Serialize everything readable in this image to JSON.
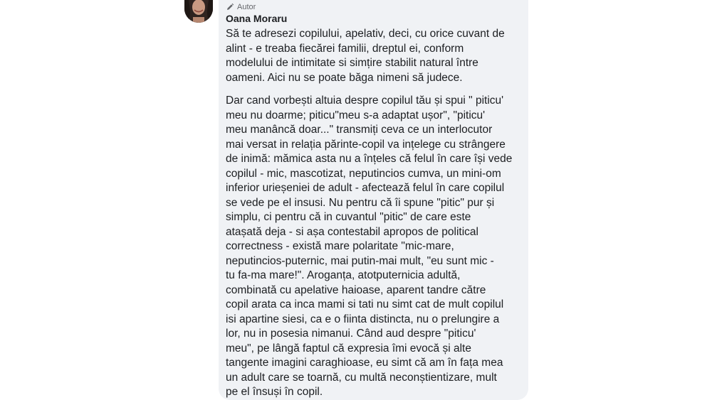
{
  "comment": {
    "badge_label": "Autor",
    "author_name": "Oana Moraru",
    "paragraph_1": [
      "Să te adresezi copilului, apelativ, deci, cu orice cuvant de",
      "alint - e treaba fiecărei familii, dreptul ei, conform",
      "modelului de intimitate si simțire stabilit natural între",
      "oameni. Aici nu se poate băga nimeni să judece."
    ],
    "paragraph_2": [
      "Dar cand vorbești altuia despre copilul tău și spui \" piticu'",
      "meu nu doarme; piticu\"meu s-a adaptat ușor\", \"piticu'",
      "meu manâncă doar...\" transmiți ceva ce un interlocutor",
      "mai versat in relația părinte-copil va ințelege cu strângere",
      "de inimă: mămica asta nu a înțeles că felul în care își vede",
      "copilul - mic, mascotizat, neputincios cumva, un mini-om",
      "inferior urieșeniei de adult - afectează felul în care copilul",
      "se vede pe el insusi. Nu pentru că îi spune \"pitic\" pur și",
      "simplu, ci pentru că in cuvantul \"pitic\" de care este",
      "atașată deja - si așa contestabil apropos de political",
      "correctness - există mare polaritate \"mic-mare,",
      "neputincios-puternic, mai putin-mai mult, \"eu sunt mic -",
      "tu fa-ma mare!\". Aroganța, atotputernicia adultă,",
      "combinată cu apelative haioase, aparent tandre către",
      "copil arata ca inca mami si tati nu simt cat de mult copilul",
      "isi apartine siesi, ca e o fiinta distincta, nu o prelungire a",
      "lor, nu in posesia nimanui. Când aud despre \"piticu'",
      "meu\", pe lângă faptul că expresia îmi evocă și alte",
      "tangente imagini caraghioase, eu simt că am în fața mea",
      "un adult care se toarnă, cu multă neconștientizare, mult",
      "pe el însuși în copil."
    ]
  }
}
